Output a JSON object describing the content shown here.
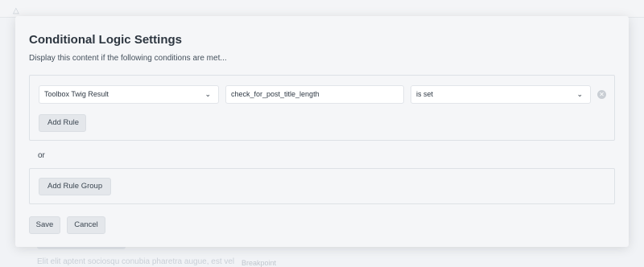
{
  "background": {
    "bell_icon": "bell-icon",
    "body_text": "Elit elit aptent sociosqu conubia pharetra augue, est vel",
    "field_label": "Breakpoint"
  },
  "modal": {
    "title": "Conditional Logic Settings",
    "subtitle": "Display this content if the following conditions are met...",
    "rule_group": {
      "rule": {
        "source": "Toolbox Twig Result",
        "value": "check_for_post_title_length",
        "operator": "is set",
        "remove_icon": "close-circle-icon"
      },
      "add_rule_label": "Add Rule"
    },
    "or_label": "or",
    "add_rule_group_label": "Add Rule Group",
    "save_label": "Save",
    "cancel_label": "Cancel"
  },
  "colors": {
    "modal_bg": "#f5f6f8",
    "button_bg": "#e4e7eb",
    "title": "#2d3640"
  }
}
